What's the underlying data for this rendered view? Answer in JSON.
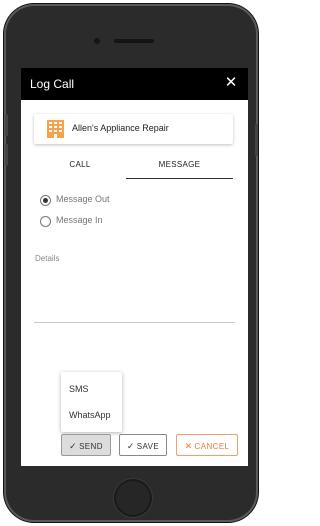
{
  "dialog": {
    "title": "Log Call",
    "close_icon": "close-icon"
  },
  "contact": {
    "icon": "building-icon",
    "name": "Allen's Appliance Repair",
    "icon_color": "#f5a34a"
  },
  "tabs": [
    {
      "label": "CALL",
      "active": false
    },
    {
      "label": "MESSAGE",
      "active": true
    }
  ],
  "direction": {
    "options": [
      {
        "label": "Message Out",
        "selected": true
      },
      {
        "label": "Message In",
        "selected": false
      }
    ]
  },
  "details": {
    "label": "Details",
    "value": ""
  },
  "send_menu": {
    "options": [
      "SMS",
      "WhatsApp"
    ]
  },
  "actions": {
    "send": {
      "label": "SEND",
      "icon": "check-icon"
    },
    "save": {
      "label": "SAVE",
      "icon": "check-icon"
    },
    "cancel": {
      "label": "CANCEL",
      "icon": "x-icon",
      "color": "#ee7a3c"
    }
  }
}
